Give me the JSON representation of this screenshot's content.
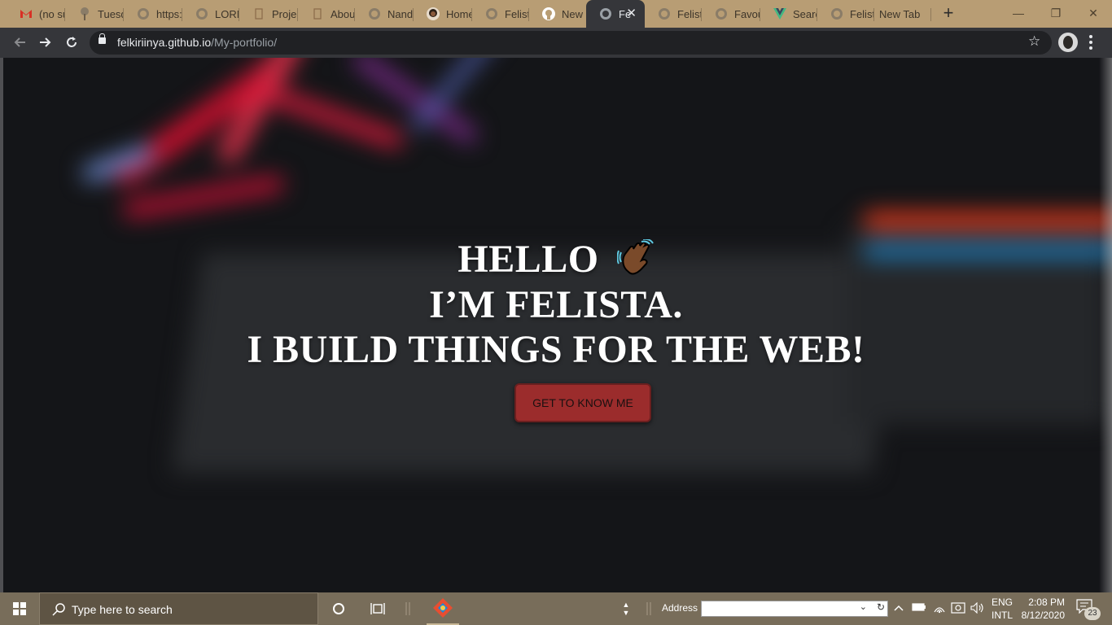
{
  "browser": {
    "tabs": [
      {
        "label": "(no su",
        "icon": "gmail-icon"
      },
      {
        "label": "Tuesd",
        "icon": "tree-icon"
      },
      {
        "label": "https:",
        "icon": "globe-icon"
      },
      {
        "label": "LORN",
        "icon": "globe-icon"
      },
      {
        "label": "Projec",
        "icon": "bookmark-icon"
      },
      {
        "label": "About",
        "icon": "bookmark-icon"
      },
      {
        "label": "Nand",
        "icon": "globe-icon"
      },
      {
        "label": "Home",
        "icon": "avatar-icon"
      },
      {
        "label": "Felista",
        "icon": "globe-icon"
      },
      {
        "label": "New I",
        "icon": "github-icon"
      },
      {
        "label": "Fe",
        "icon": "globe-icon",
        "active": true
      },
      {
        "label": "Felista",
        "icon": "globe-icon"
      },
      {
        "label": "Favou",
        "icon": "globe-icon"
      },
      {
        "label": "Searc",
        "icon": "vue-icon"
      },
      {
        "label": "Felista",
        "icon": "globe-icon"
      },
      {
        "label": "New Tab",
        "icon": ""
      }
    ],
    "close_glyph": "✕",
    "new_tab_glyph": "+",
    "window_controls": {
      "minimize": "—",
      "maximize": "❐",
      "close": "✕"
    },
    "url": {
      "host": "felkiriinya.github.io",
      "path": "/My-portfolio/"
    },
    "colors": {
      "frame": "#b89d74",
      "toolbar": "#35363a",
      "omnibox": "#202124"
    }
  },
  "page": {
    "hero": {
      "line1": "HELLO",
      "line1_emoji": "waving-hand-icon",
      "line2": "I’M FELISTA.",
      "line3": "I BUILD THINGS FOR THE WEB!"
    },
    "cta_label": "GET TO KNOW ME",
    "colors": {
      "cta": "#9b2c2c",
      "text": "#ffffff",
      "background": "#141518"
    }
  },
  "taskbar": {
    "search_placeholder": "Type here to search",
    "address_label": "Address",
    "address_value": "",
    "language": {
      "line1": "ENG",
      "line2": "INTL"
    },
    "time": "2:08 PM",
    "date": "8/12/2020",
    "notifications_count": "23",
    "colors": {
      "bar": "#786d5a",
      "search": "#5e5444"
    }
  }
}
